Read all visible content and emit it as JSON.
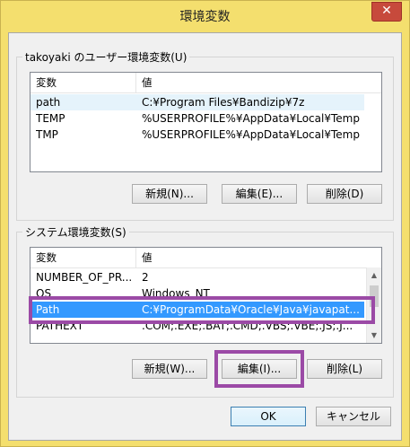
{
  "window": {
    "title": "環境変数",
    "close_glyph": "✕"
  },
  "user_group": {
    "legend": "takoyaki のユーザー環境変数(U)",
    "columns": [
      "変数",
      "値"
    ],
    "rows": [
      {
        "name": "path",
        "value": "C:¥Program Files¥Bandizip¥7z"
      },
      {
        "name": "TEMP",
        "value": "%USERPROFILE%¥AppData¥Local¥Temp"
      },
      {
        "name": "TMP",
        "value": "%USERPROFILE%¥AppData¥Local¥Temp"
      }
    ],
    "buttons": {
      "new": "新規(N)...",
      "edit": "編集(E)...",
      "delete": "削除(D)"
    }
  },
  "system_group": {
    "legend": "システム環境変数(S)",
    "columns": [
      "変数",
      "値"
    ],
    "rows": [
      {
        "name": "NUMBER_OF_PR...",
        "value": "2"
      },
      {
        "name": "OS",
        "value": "Windows_NT"
      },
      {
        "name": "Path",
        "value": "C:¥ProgramData¥Oracle¥Java¥javapat..."
      },
      {
        "name": "PATHEXT",
        "value": ".COM;.EXE;.BAT;.CMD;.VBS;.VBE;.JS;.J..."
      }
    ],
    "selected_row": "Path",
    "buttons": {
      "new": "新規(W)...",
      "edit": "編集(I)...",
      "delete": "削除(L)"
    }
  },
  "dialog_buttons": {
    "ok": "OK",
    "cancel": "キャンセル"
  },
  "colors": {
    "title_bar": "#f4df6e",
    "selection": "#3399ff",
    "annotation": "#9b4aa6"
  }
}
